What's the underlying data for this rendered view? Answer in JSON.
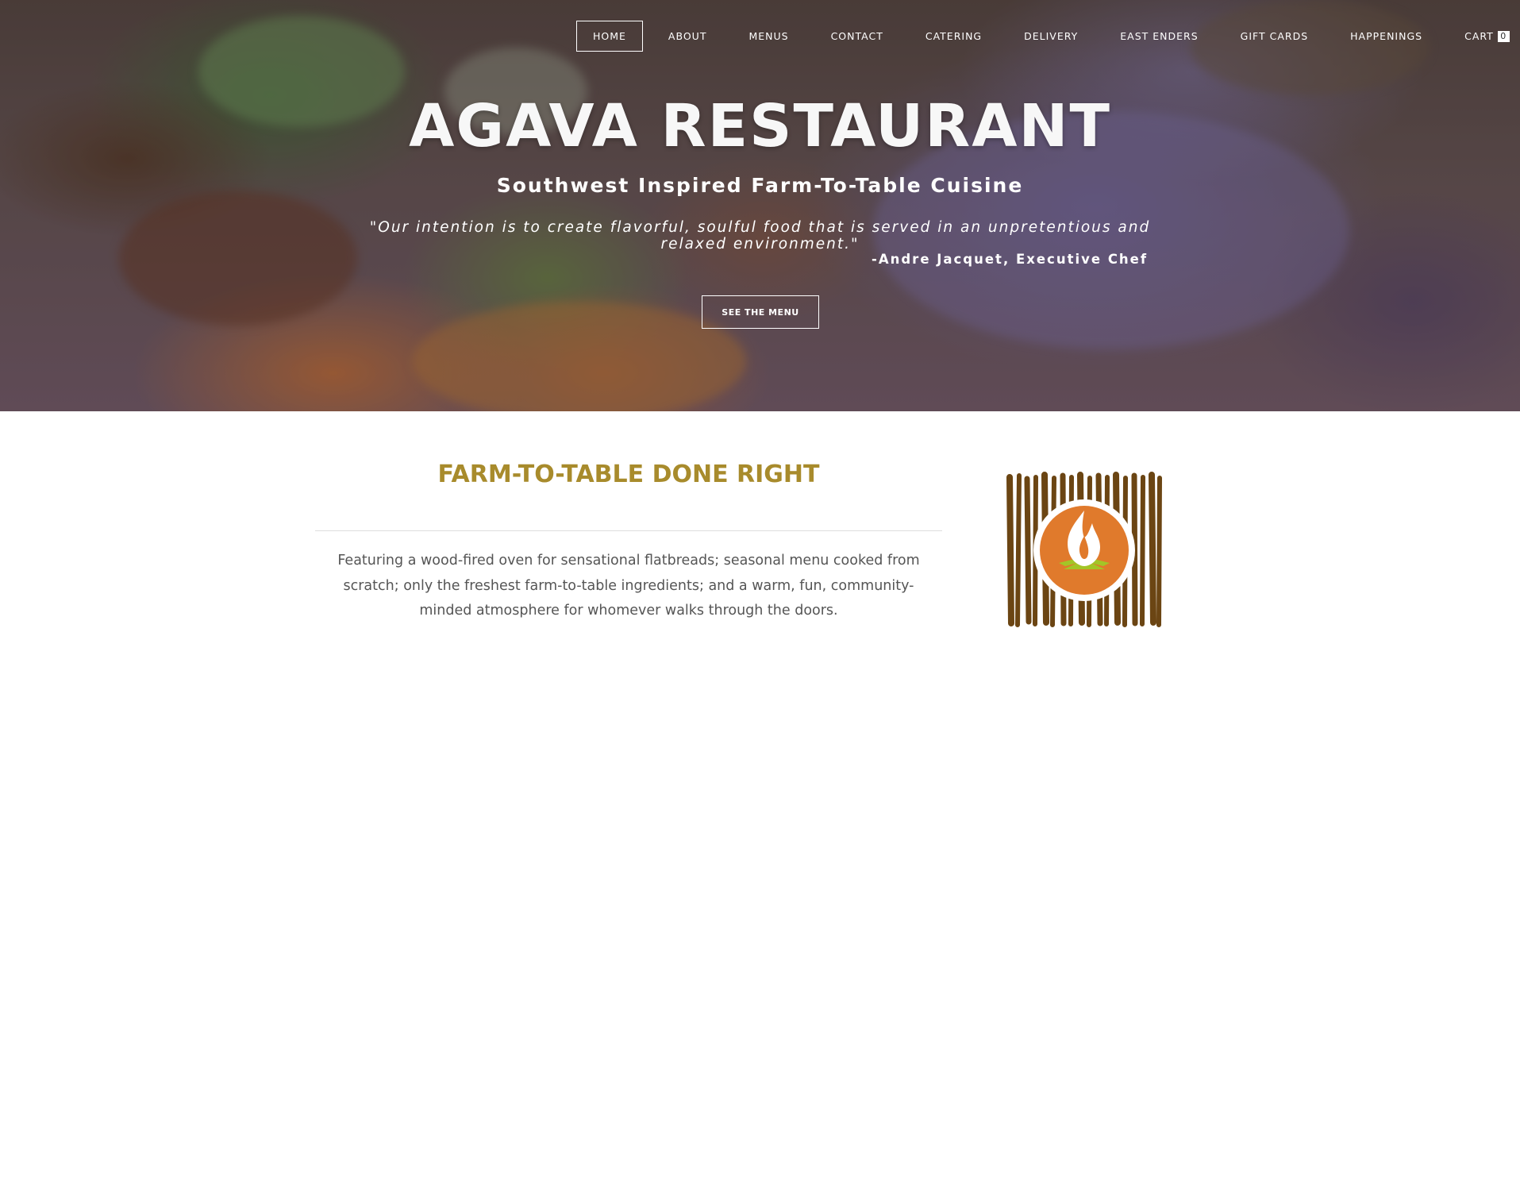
{
  "nav": {
    "items": [
      {
        "label": "HOME",
        "active": true
      },
      {
        "label": "ABOUT",
        "active": false
      },
      {
        "label": "MENUS",
        "active": false
      },
      {
        "label": "CONTACT",
        "active": false
      },
      {
        "label": "CATERING",
        "active": false
      },
      {
        "label": "DELIVERY",
        "active": false
      },
      {
        "label": "EAST ENDERS",
        "active": false
      },
      {
        "label": "GIFT CARDS",
        "active": false
      },
      {
        "label": "HAPPENINGS",
        "active": false
      }
    ],
    "cart_label": "CART",
    "cart_count": "0"
  },
  "hero": {
    "title": "AGAVA RESTAURANT",
    "subtitle": "Southwest Inspired Farm-To-Table Cuisine",
    "quote": "\"Our intention is to create flavorful, soulful food that is served in an unpretentious and relaxed environment.\"",
    "attribution": "-Andre Jacquet, Executive Chef",
    "button_label": "SEE THE MENU"
  },
  "section": {
    "title": "FARM-TO-TABLE DONE RIGHT",
    "body": "Featuring a wood-fired oven for sensational flatbreads; seasonal menu cooked from scratch; only the freshest farm-to-table ingredients; and a warm, fun, community-minded atmosphere for whomever walks through the doors."
  },
  "colors": {
    "heading_gold": "#a88b2c",
    "body_text": "#555555",
    "logo_wood": "#6b4513",
    "logo_orange": "#e07a2c",
    "logo_green": "#a3c527"
  },
  "logo": {
    "icon": "flame-logo-icon"
  }
}
